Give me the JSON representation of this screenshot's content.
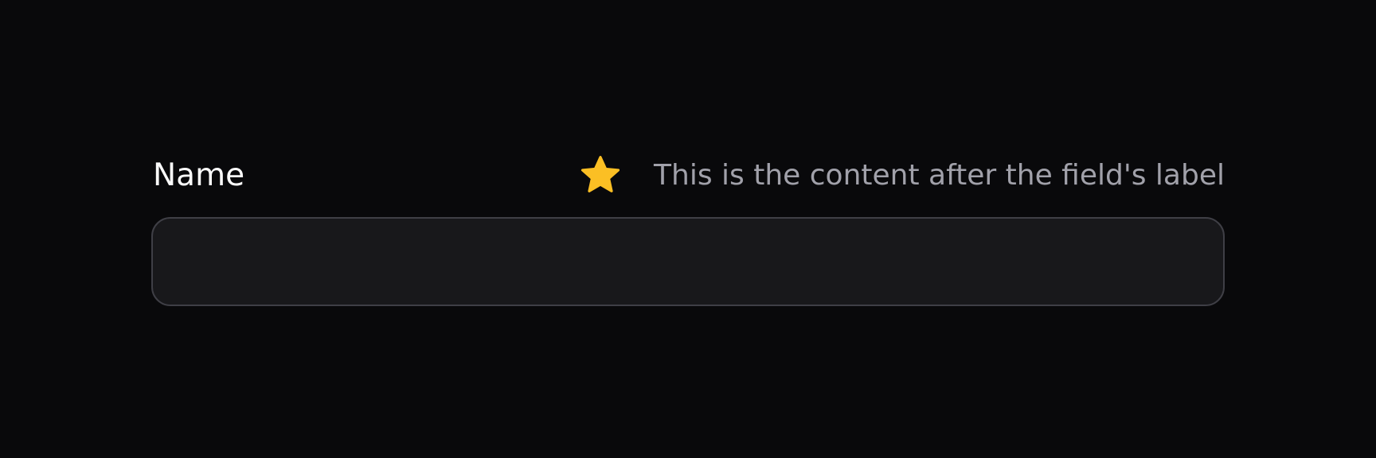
{
  "field": {
    "label": "Name",
    "after_label_icon": "star-icon",
    "after_label_text": "This is the content after the field's label",
    "input_value": "",
    "input_placeholder": ""
  },
  "colors": {
    "background": "#09090b",
    "label": "#fafafa",
    "muted_text": "#a1a1aa",
    "star": "#fbbf24",
    "input_bg": "#18181b",
    "input_border": "#3f3f46"
  }
}
